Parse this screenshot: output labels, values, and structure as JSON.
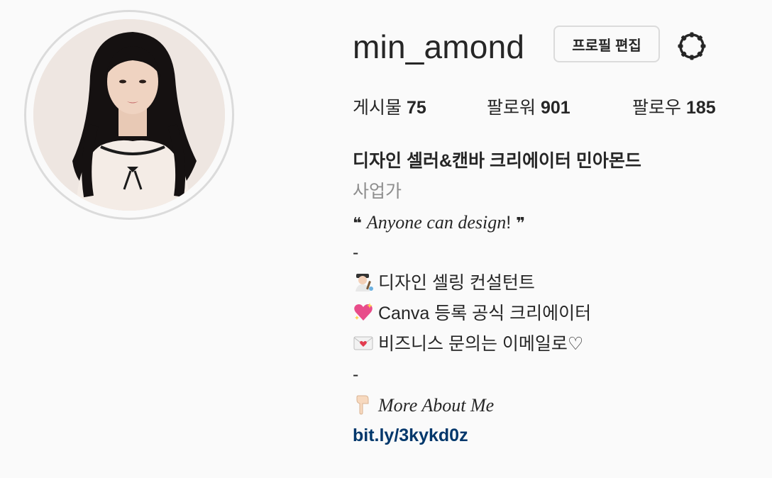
{
  "profile": {
    "username": "min_amond",
    "edit_button_label": "프로필 편집",
    "settings_icon": "gear-icon"
  },
  "stats": {
    "posts_label": "게시물",
    "posts_count": "75",
    "followers_label": "팔로워",
    "followers_count": "901",
    "following_label": "팔로우",
    "following_count": "185"
  },
  "bio": {
    "full_name": "디자인 셀러&캔바 크리에이터 민아몬드",
    "category": "사업가",
    "quote_open": "❝",
    "tagline_italic": "Anyone can design",
    "tagline_mark": "!",
    "quote_close": "❞",
    "divider_1": "-",
    "line_consultant": "디자인 셀링 컨설턴트",
    "line_canva": "Canva 등록 공식 크리에이터",
    "line_business": "비즈니스 문의는 이메일로♡",
    "divider_2": "-",
    "more_about": "More About Me",
    "link": "bit.ly/3kykd0z"
  },
  "icons": {
    "consultant": "artist-emoji-icon",
    "canva": "sparkling-heart-icon",
    "business": "love-letter-icon",
    "more_about": "pointing-down-icon"
  },
  "colors": {
    "background": "#fafafa",
    "text": "#262626",
    "secondary": "#8e8e8e",
    "link": "#00376b",
    "border": "#dbdbdb"
  }
}
